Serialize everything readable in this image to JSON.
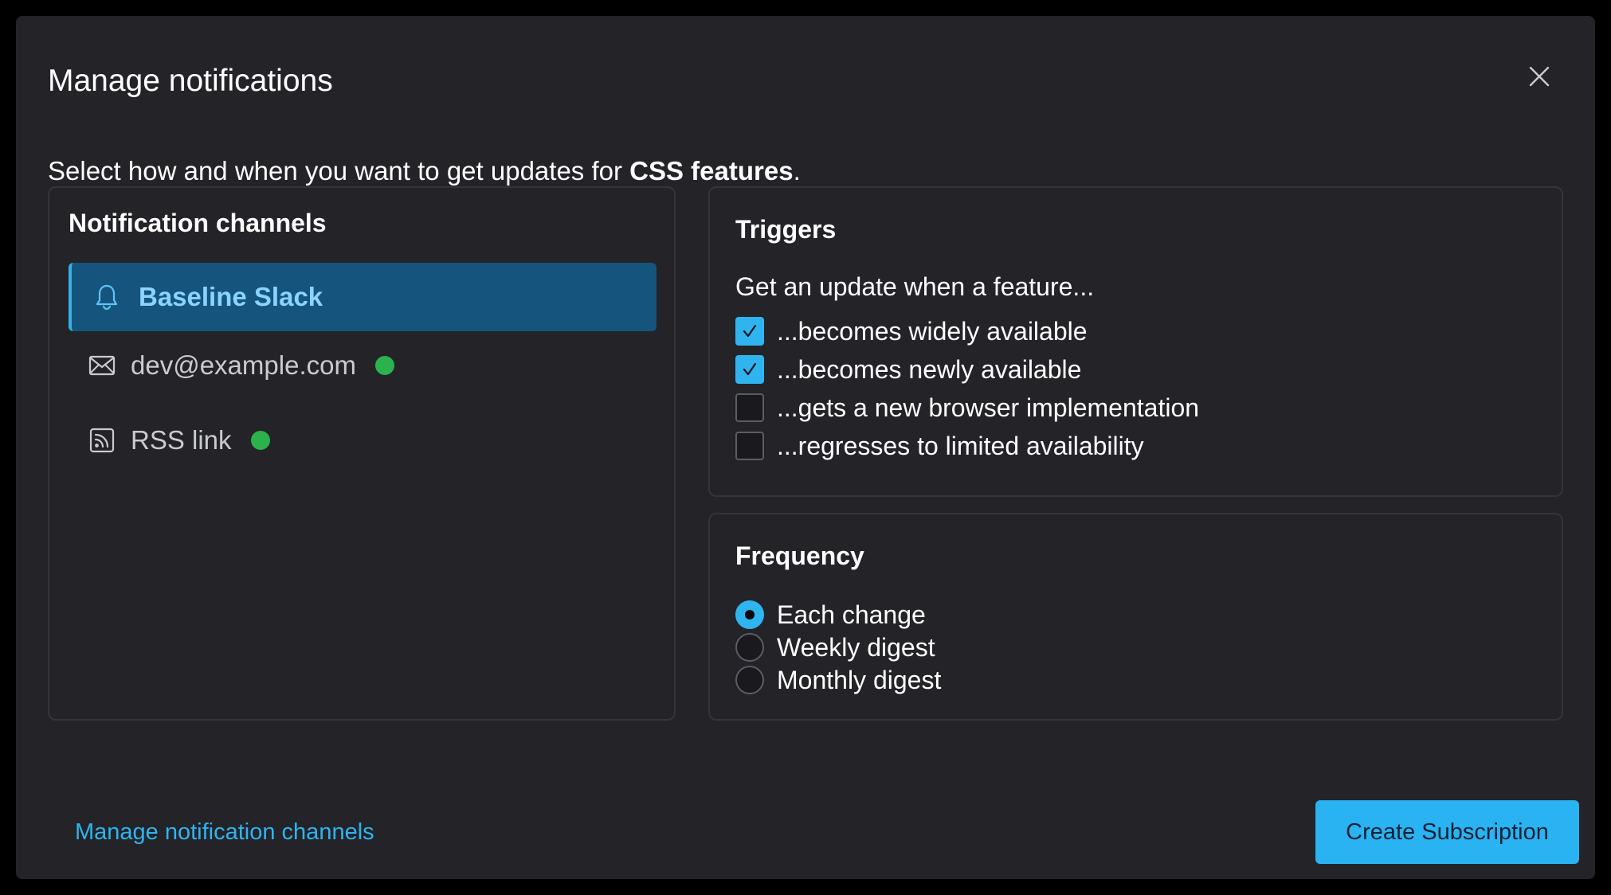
{
  "dialog": {
    "title": "Manage notifications",
    "intro_prefix": "Select how and when you want to get updates for ",
    "intro_subject": "CSS features",
    "intro_suffix": "."
  },
  "channels": {
    "heading": "Notification channels",
    "items": [
      {
        "label": "Baseline Slack",
        "icon": "bell-icon",
        "selected": true,
        "status": ""
      },
      {
        "label": "dev@example.com",
        "icon": "envelope-icon",
        "selected": false,
        "status": "active"
      },
      {
        "label": "RSS link",
        "icon": "rss-icon",
        "selected": false,
        "status": "active"
      }
    ]
  },
  "triggers": {
    "heading": "Triggers",
    "subtitle": "Get an update when a feature...",
    "options": [
      {
        "label": "...becomes widely available",
        "checked": true
      },
      {
        "label": "...becomes newly available",
        "checked": true
      },
      {
        "label": "...gets a new browser implementation",
        "checked": false
      },
      {
        "label": "...regresses to limited availability",
        "checked": false
      }
    ]
  },
  "frequency": {
    "heading": "Frequency",
    "options": [
      {
        "label": "Each change",
        "selected": true
      },
      {
        "label": "Weekly digest",
        "selected": false
      },
      {
        "label": "Monthly digest",
        "selected": false
      }
    ]
  },
  "footer": {
    "manage_link": "Manage notification channels",
    "create_button": "Create Subscription"
  },
  "colors": {
    "accent": "#29b3f2",
    "selected_channel_bg": "#15547c",
    "status_active": "#2bb24c",
    "dialog_bg": "#232328"
  }
}
